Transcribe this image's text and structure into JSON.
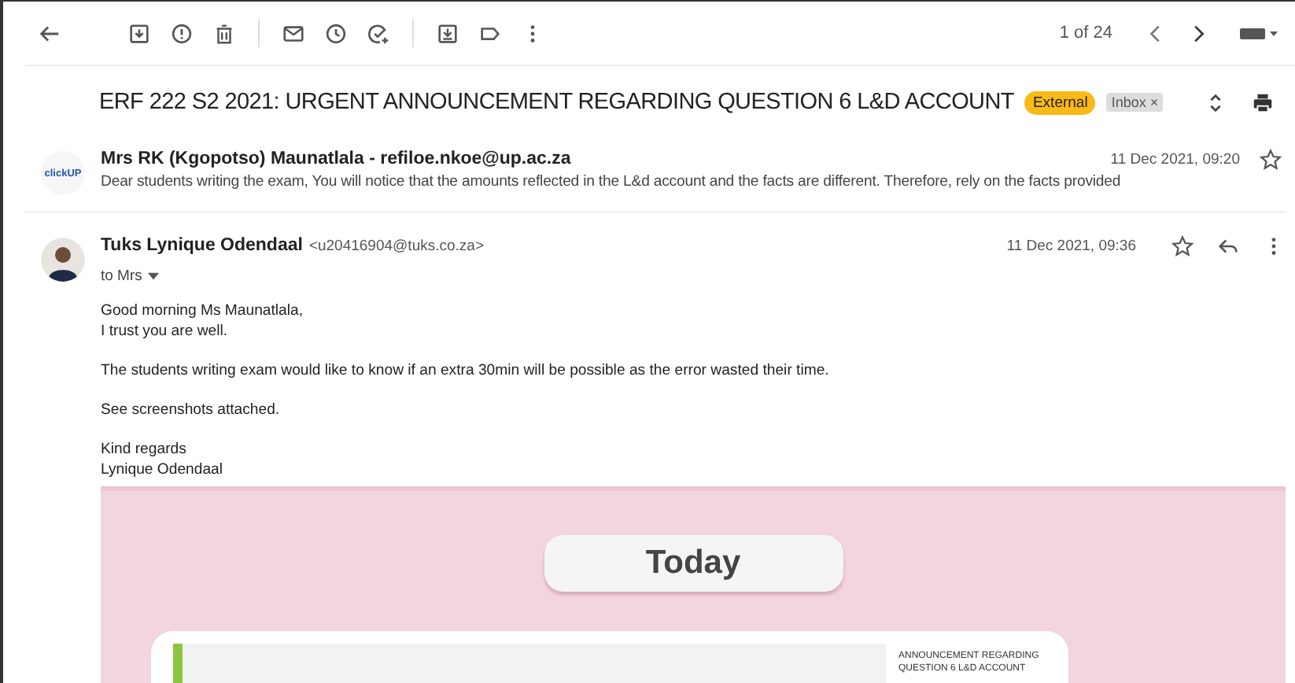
{
  "toolbar": {
    "pager": "1 of 24"
  },
  "subject": {
    "title": "ERF 222 S2 2021: URGENT ANNOUNCEMENT REGARDING QUESTION 6 L&D ACCOUNT",
    "labels": [
      {
        "text": "External",
        "kind": "badge",
        "color": "#f9ba17"
      },
      {
        "text": "Inbox",
        "kind": "chip",
        "color": "#dddddd",
        "close": "×"
      }
    ]
  },
  "messages": [
    {
      "kind": "collapsed",
      "avatar_text": "clickUP",
      "sender": "Mrs RK (Kgopotso) Maunatlala - refiloe.nkoe@up.ac.za",
      "date": "11 Dec 2021, 09:20",
      "starred": false,
      "snippet": "Dear students writing the exam, You will notice that the amounts reflected in the L&d account and the facts are different. Therefore, rely on the facts provided"
    },
    {
      "kind": "expanded",
      "sender": "Tuks Lynique Odendaal",
      "email": "<u20416904@tuks.co.za>",
      "to": "to Mrs",
      "date": "11 Dec 2021, 09:36",
      "starred": false,
      "body": [
        [
          "Good morning Ms Maunatlala,",
          "I trust you are well."
        ],
        [
          "The students writing exam would like to know if an extra 30min will be possible as the error wasted their time."
        ],
        [
          "See screenshots attached."
        ],
        [
          "Kind regards",
          "Lynique Odendaal"
        ]
      ],
      "attachment": {
        "pill": "Today",
        "card_text": "ANNOUNCEMENT REGARDING QUESTION 6 L&D ACCOUNT"
      }
    }
  ]
}
